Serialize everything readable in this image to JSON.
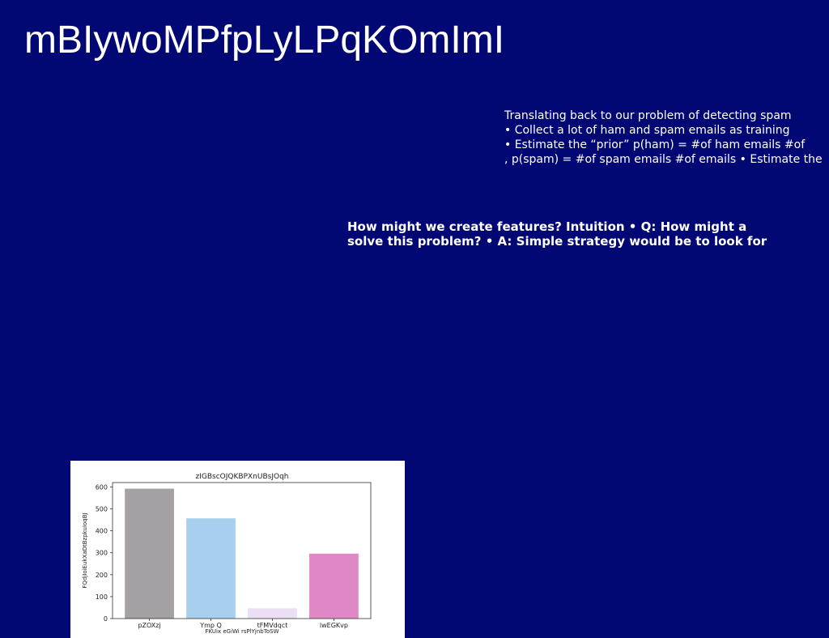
{
  "slide": {
    "title": "mBIywoMPfpLyLPqKOmImI",
    "paragraph1": [
      "Translating back to our problem of detecting spam",
      "• Collect a lot of ham and spam emails as training",
      "• Estimate the “prior” p(ham) = #of ham emails #of",
      ", p(spam) = #of spam emails #of emails • Estimate the"
    ],
    "paragraph2": [
      "How might we create features? Intuition • Q: How might a",
      "solve this problem? • A: Simple strategy would be to look for"
    ]
  },
  "chart_data": {
    "type": "bar",
    "title": "zIGBscOJQKBPXnUBsJOqh",
    "xlabel": "FKUix eGiWi rsPlYjnbToSW",
    "ylabel": "FQdjIoiEukXaDtBzpkuIoqBJ",
    "categories": [
      "pZOXzj",
      "Ymp Q",
      "tFMVdqct",
      "lwEGKvp"
    ],
    "values": [
      592,
      457,
      47,
      296
    ],
    "colors": [
      "#a5a0a4",
      "#a9cfee",
      "#ebdff6",
      "#de88c6"
    ],
    "ylim": [
      0,
      620
    ],
    "yticks": [
      0,
      100,
      200,
      300,
      400,
      500,
      600
    ],
    "grid": false
  }
}
